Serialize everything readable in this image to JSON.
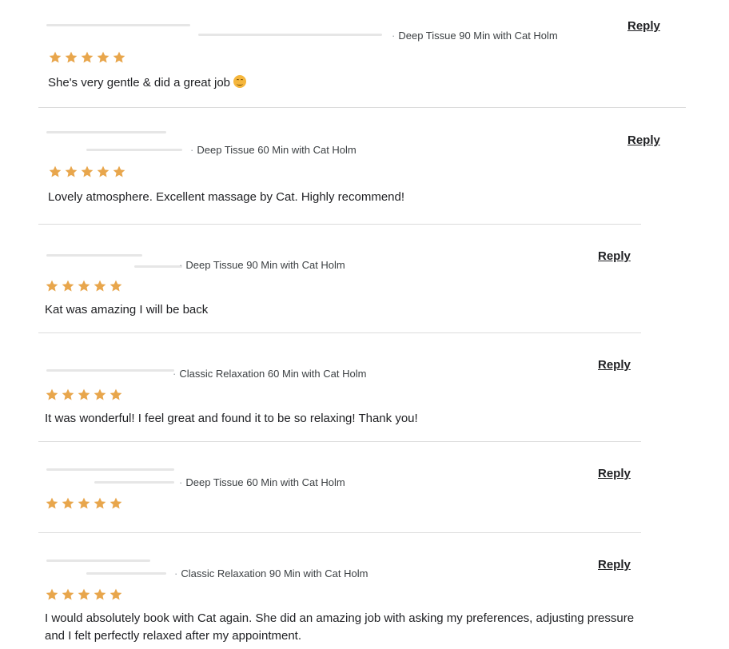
{
  "colors": {
    "star": "#e8a64c",
    "divider": "#dcdcdc"
  },
  "reviews": [
    {
      "service": "Deep Tissue 90 Min with Cat Holm",
      "rating": 5,
      "text": "She's very gentle & did a great job",
      "has_emoji": true,
      "emoji_icon": "smiling-face-icon",
      "reply_label": "Reply"
    },
    {
      "service": "Deep Tissue 60 Min with Cat Holm",
      "rating": 5,
      "text": "Lovely atmosphere. Excellent massage by Cat. Highly recommend!",
      "reply_label": "Reply"
    },
    {
      "service": "Deep Tissue 90 Min with Cat Holm",
      "rating": 5,
      "text": "Kat was amazing I will be back",
      "reply_label": "Reply"
    },
    {
      "service": "Classic Relaxation 60 Min with Cat Holm",
      "rating": 5,
      "text": "It was wonderful! I feel great and found it to be so relaxing! Thank you!",
      "reply_label": "Reply"
    },
    {
      "service": "Deep Tissue 60 Min with Cat Holm",
      "rating": 5,
      "text": "",
      "reply_label": "Reply"
    },
    {
      "service": "Classic Relaxation 90 Min with Cat Holm",
      "rating": 5,
      "text": "I would absolutely book with Cat again. She did an amazing job with asking my preferences, adjusting pressure and I felt perfectly relaxed after my appointment.",
      "reply_label": "Reply"
    }
  ]
}
